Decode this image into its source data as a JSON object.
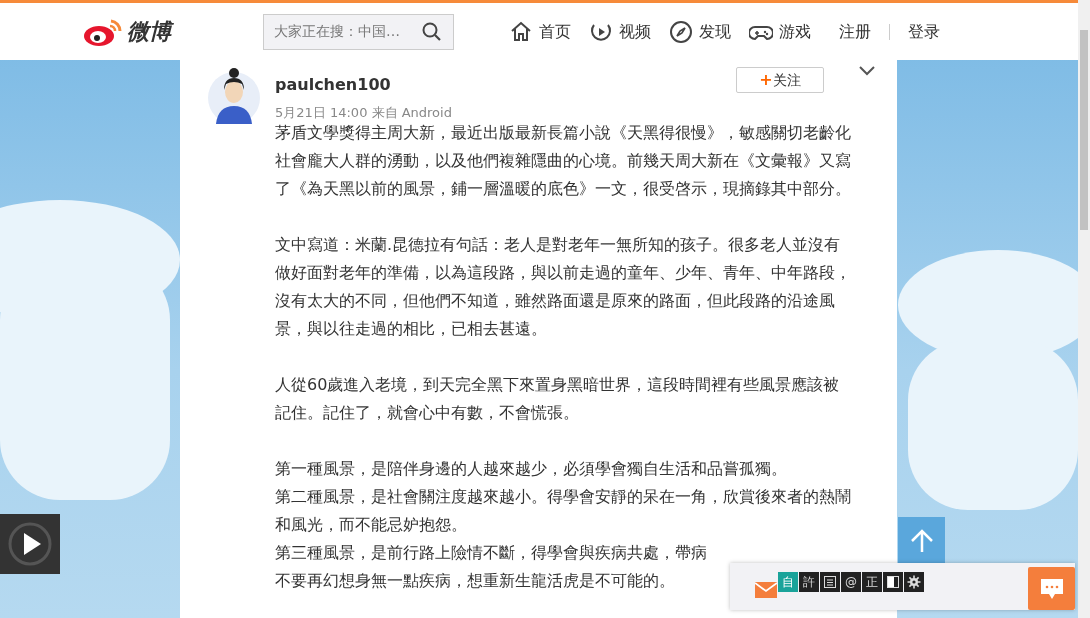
{
  "header": {
    "logo_text": "微博",
    "search": {
      "placeholder": "大家正在搜：中国…"
    },
    "nav": [
      {
        "label": "首页"
      },
      {
        "label": "视频"
      },
      {
        "label": "发现"
      },
      {
        "label": "游戏"
      }
    ],
    "account": [
      {
        "label": "注册"
      },
      {
        "label": "登录"
      }
    ]
  },
  "post": {
    "author": "paulchen100",
    "meta": "5月21日 14:00 来自 Android",
    "follow_label": "关注",
    "follow_sign": "+",
    "sections": [
      [
        "茅盾文學獎得主周大新，最近出版最新長篇小說《天黑得很慢》，敏感關切老齡化社會龐大人群的湧動，以及他們複雜隱曲的心境。前幾天周大新在《文彙報》又寫了《為天黑以前的風景，鋪一層溫暖的底色》一文，很受啓示，現摘錄其中部分。"
      ],
      [
        "文中寫道：米蘭.昆德拉有句話：老人是對老年一無所知的孩子。很多老人並沒有做好面對老年的準備，以為這段路，與以前走過的童年、少年、青年、中年路段，沒有太大的不同，但他們不知道，雖然路面還是原來的路面，但此段路的沿途風景，與以往走過的相比，已相去甚遠。"
      ],
      [
        "人從60歲進入老境，到天完全黑下來置身黑暗世界，這段時間裡有些風景應該被記住。記住了，就會心中有數，不會慌張。"
      ],
      [
        "第一種風景，是陪伴身邊的人越來越少，必須學會獨自生活和品嘗孤獨。",
        "第二種風景，是社會關注度越來越小。得學會安靜的呆在一角，欣賞後來者的熱鬧和風光，而不能忌妒抱怨。",
        "第三種風景，是前行路上險情不斷，得學會與疾病共處，帶病",
        "不要再幻想身無一點疾病，想重新生龍活虎是不可能的。"
      ]
    ]
  },
  "toolbar": [
    {
      "label": "自",
      "selected": true
    },
    {
      "label": "許",
      "selected": false
    },
    {
      "label": "@",
      "selected": false
    },
    {
      "label": "正",
      "selected": false
    }
  ]
}
